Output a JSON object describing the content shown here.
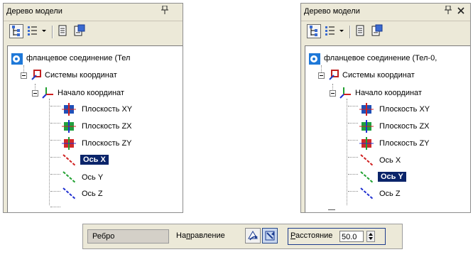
{
  "left_panel": {
    "title": "Дерево модели",
    "pin_glyph": "ф",
    "tree": {
      "root": "фланцевое соединение (Тел",
      "systems": "Системы координат",
      "origin": "Начало координат",
      "plane_xy": "Плоскость XY",
      "plane_zx": "Плоскость ZX",
      "plane_zy": "Плоскость ZY",
      "axis_x": "Ось X",
      "axis_y": "Ось Y",
      "axis_z": "Ось Z"
    },
    "selected": "axis_x"
  },
  "right_panel": {
    "title": "Дерево модели",
    "pin_glyph": "ф",
    "close_glyph": "✕",
    "tree": {
      "root": "фланцевое соединение (Тел-0,",
      "systems": "Системы координат",
      "origin": "Начало координат",
      "plane_xy": "Плоскость XY",
      "plane_zx": "Плоскость ZX",
      "plane_zy": "Плоскость ZY",
      "axis_x": "Ось X",
      "axis_y": "Ось Y",
      "axis_z": "Ось Z"
    },
    "selected": "axis_y"
  },
  "property_bar": {
    "edge_field": "Ребро",
    "direction_label_a": "На",
    "direction_label_u": "п",
    "direction_label_b": "равление",
    "distance_label_u": "Р",
    "distance_label_b": "асстояние",
    "distance_value": "50.0"
  },
  "icons": {
    "tree_toolbar": [
      "tree-structure-icon",
      "list-view-icon",
      "dropdown-arrow-icon",
      "document-icon",
      "document-properties-icon"
    ],
    "model": "part-model-icon",
    "coord_systems": "coordinate-system-icon",
    "origin": "origin-axes-icon",
    "planes": [
      "plane-xy-icon",
      "plane-zx-icon",
      "plane-zy-icon"
    ],
    "axes": [
      "axis-x-icon",
      "axis-y-icon",
      "axis-z-icon"
    ]
  },
  "colors": {
    "selection": "#0a246a",
    "panel_bg": "#ece9d8",
    "axis_x": "#d02020",
    "axis_y": "#20a030",
    "axis_z": "#2030d0",
    "plane_xy": "#2050b8",
    "plane_zx": "#20a040",
    "plane_zy": "#d02a2a"
  }
}
